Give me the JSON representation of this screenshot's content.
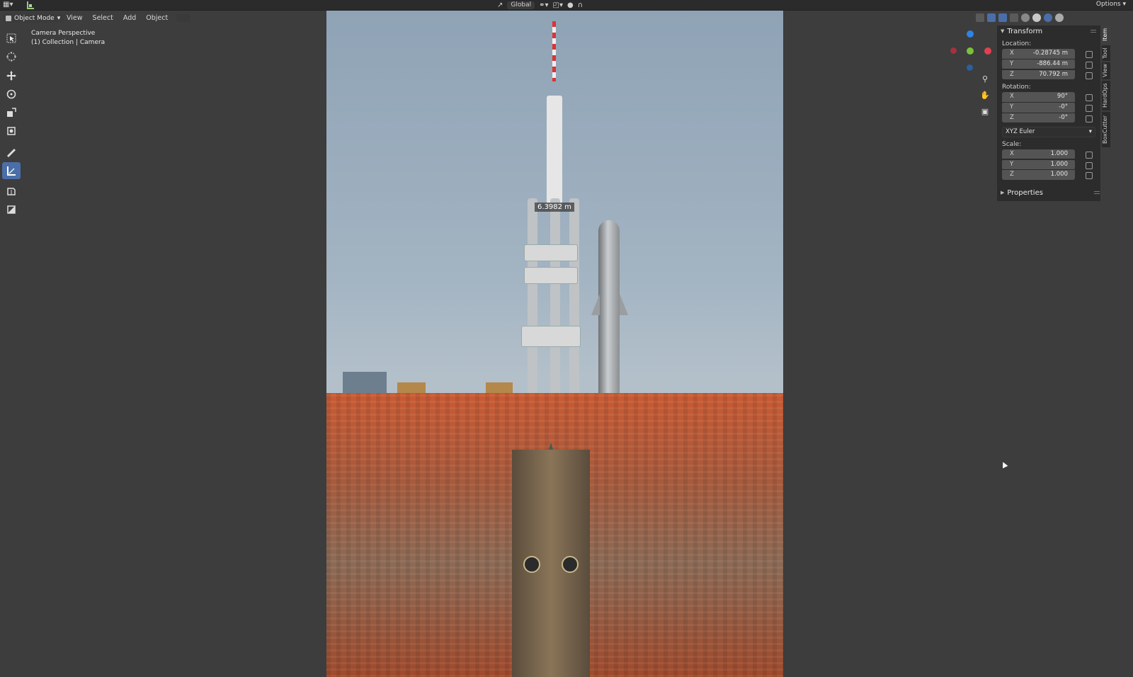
{
  "topbar": {
    "view_mode": "Global",
    "options_label": "Options"
  },
  "viewport_header": {
    "mode": "Object Mode",
    "menus": [
      "View",
      "Select",
      "Add",
      "Object"
    ]
  },
  "overlay": {
    "view_name": "Camera Perspective",
    "collection": "(1) Collection | Camera"
  },
  "measure_label": "6.3982 m",
  "npanel": {
    "transform_title": "Transform",
    "location_label": "Location:",
    "location": [
      {
        "axis": "X",
        "value": "-0.28745 m"
      },
      {
        "axis": "Y",
        "value": "-886.44 m"
      },
      {
        "axis": "Z",
        "value": "70.792 m"
      }
    ],
    "rotation_label": "Rotation:",
    "rotation": [
      {
        "axis": "X",
        "value": "90°"
      },
      {
        "axis": "Y",
        "value": "-0°"
      },
      {
        "axis": "Z",
        "value": "-0°"
      }
    ],
    "rotation_mode": "XYZ Euler",
    "scale_label": "Scale:",
    "scale": [
      {
        "axis": "X",
        "value": "1.000"
      },
      {
        "axis": "Y",
        "value": "1.000"
      },
      {
        "axis": "Z",
        "value": "1.000"
      }
    ],
    "properties_title": "Properties"
  },
  "side_tabs": [
    "Item",
    "Tool",
    "View",
    "HardOps",
    "BoxCutter"
  ],
  "gizmo": {
    "z_label": "Z",
    "x_label": "X",
    "y_label": "Y",
    "colors": {
      "x": "#e2404f",
      "y": "#7ac23a",
      "z": "#2f83e4"
    }
  },
  "toolbar_tools": [
    "select-box-icon",
    "cursor-icon",
    "move-icon",
    "rotate-icon",
    "scale-icon",
    "transform-icon",
    "annotate-icon",
    "measure-icon",
    "add-cube-icon",
    "add-plane-icon"
  ]
}
